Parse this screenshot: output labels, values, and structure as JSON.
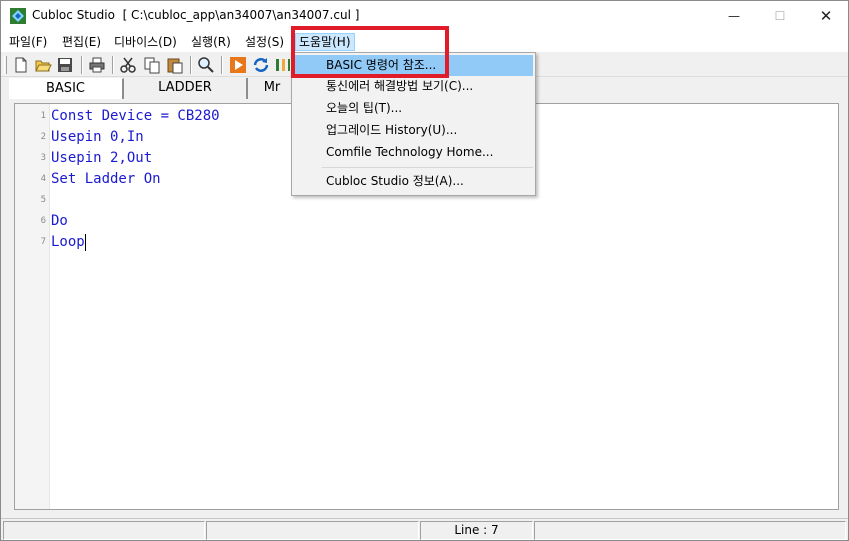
{
  "window": {
    "app_name": "Cubloc Studio",
    "file_path": "[ C:\\cubloc_app\\an34007\\an34007.cul ]",
    "minimize_icon": "minimize-icon",
    "maximize_icon": "maximize-icon",
    "close_icon": "close-icon"
  },
  "menubar": {
    "items": [
      {
        "label": "파일(F)"
      },
      {
        "label": "편집(E)"
      },
      {
        "label": "디바이스(D)"
      },
      {
        "label": "실행(R)"
      },
      {
        "label": "설정(S)"
      },
      {
        "label": "도움말(H)"
      }
    ]
  },
  "toolbar": {
    "icons": [
      "new-file-icon",
      "open-folder-icon",
      "save-icon",
      "print-icon",
      "cut-icon",
      "copy-icon",
      "paste-icon",
      "find-icon",
      "run-icon",
      "refresh-icon",
      "ladder-icon"
    ]
  },
  "tabs": [
    {
      "label": "BASIC"
    },
    {
      "label": "LADDER"
    },
    {
      "label": "Mr"
    }
  ],
  "editor": {
    "lines": [
      {
        "num": "1",
        "code": "Const Device = CB280"
      },
      {
        "num": "2",
        "code": "Usepin 0,In"
      },
      {
        "num": "3",
        "code": "Usepin 2,Out"
      },
      {
        "num": "4",
        "code": "Set Ladder On"
      },
      {
        "num": "5",
        "code": ""
      },
      {
        "num": "6",
        "code": "Do"
      },
      {
        "num": "7",
        "code": "Loop"
      }
    ],
    "text_color": "#1a1ad0"
  },
  "help_menu": {
    "items": [
      {
        "label": "BASIC 명령어 참조..."
      },
      {
        "label": "통신에러 해결방법 보기(C)..."
      },
      {
        "label": "오늘의 팁(T)..."
      },
      {
        "label": "업그레이드 History(U)..."
      },
      {
        "label": "Comfile Technology Home..."
      },
      {
        "label": "Cubloc Studio  정보(A)..."
      }
    ],
    "highlight_color": "#91c9f7"
  },
  "statusbar": {
    "line_indicator": "Line : 7"
  },
  "annotation_color": "#e01c2a"
}
